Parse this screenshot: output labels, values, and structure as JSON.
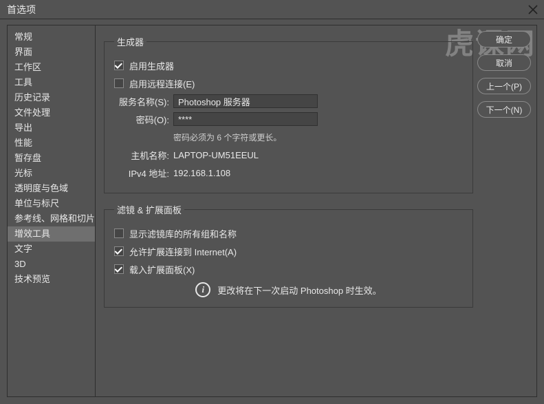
{
  "window": {
    "title": "首选项"
  },
  "sidebar": {
    "items": [
      {
        "label": "常规"
      },
      {
        "label": "界面"
      },
      {
        "label": "工作区"
      },
      {
        "label": "工具"
      },
      {
        "label": "历史记录"
      },
      {
        "label": "文件处理"
      },
      {
        "label": "导出"
      },
      {
        "label": "性能"
      },
      {
        "label": "暂存盘"
      },
      {
        "label": "光标"
      },
      {
        "label": "透明度与色域"
      },
      {
        "label": "单位与标尺"
      },
      {
        "label": "参考线、网格和切片"
      },
      {
        "label": "增效工具"
      },
      {
        "label": "文字"
      },
      {
        "label": "3D"
      },
      {
        "label": "技术预览"
      }
    ],
    "selected_index": 13
  },
  "buttons": {
    "ok": "确定",
    "cancel": "取消",
    "prev": "上一个(P)",
    "next": "下一个(N)"
  },
  "generator": {
    "legend": "生成器",
    "enable_generator": "启用生成器",
    "enable_remote": "启用远程连接(E)",
    "service_label": "服务名称(S):",
    "service_value": "Photoshop 服务器",
    "password_label": "密码(O):",
    "password_value": "****",
    "password_helper": "密码必须为 6 个字符或更长。",
    "host_label": "主机名称:",
    "host_value": "LAPTOP-UM51EEUL",
    "ip_label": "IPv4 地址:",
    "ip_value": "192.168.1.108"
  },
  "extensions": {
    "legend": "滤镜 & 扩展面板",
    "show_filter_lib": "显示滤镜库的所有组和名称",
    "allow_internet": "允许扩展连接到 Internet(A)",
    "load_panels": "载入扩展面板(X)",
    "restart_notice": "更改将在下一次启动 Photoshop 时生效。"
  },
  "watermark": "虎课网"
}
